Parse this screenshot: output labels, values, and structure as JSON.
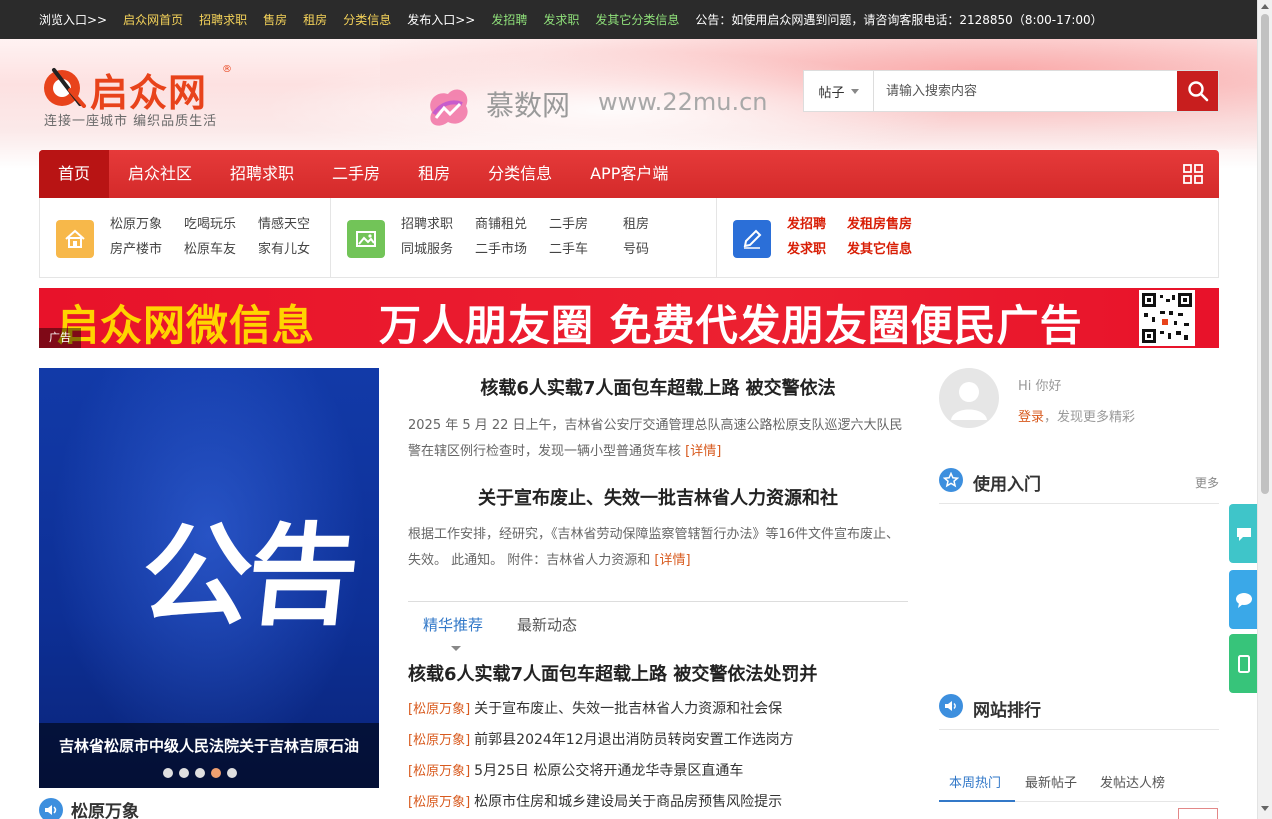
{
  "topbar": {
    "browse_label": "浏览入口>>",
    "home": "启众网首页",
    "jobs": "招聘求职",
    "sell_house": "售房",
    "rent": "租房",
    "classified": "分类信息",
    "publish_label": "发布入口>>",
    "post_job": "发招聘",
    "post_seek": "发求职",
    "post_other": "发其它分类信息",
    "notice": "公告：如使用启众网遇到问题，请咨询客服电话：2128850（8:00-17:00）"
  },
  "logo": {
    "name": "启众网",
    "reg": "®",
    "slogan": "连接一座城市  编织品质生活"
  },
  "watermark": {
    "text": "慕数网",
    "url": "www.22mu.cn"
  },
  "search": {
    "type": "帖子",
    "placeholder": "请输入搜索内容"
  },
  "nav": {
    "items": [
      "首页",
      "启众社区",
      "招聘求职",
      "二手房",
      "租房",
      "分类信息",
      "APP客户端"
    ]
  },
  "quick": {
    "community": [
      "松原万象",
      "吃喝玩乐",
      "情感天空",
      "房产楼市",
      "松原车友",
      "家有儿女"
    ],
    "services": [
      "招聘求职",
      "商铺租兑",
      "二手房",
      "租房",
      "同城服务",
      "二手市场",
      "二手车",
      "号码"
    ],
    "publish": [
      "发招聘",
      "发租房售房",
      "发求职",
      "发其它信息"
    ]
  },
  "banner": {
    "text1": "启众网微信息",
    "text2": "万人朋友圈 免费代发朋友圈便民广告",
    "tag": "广告"
  },
  "slide": {
    "big_text": "公告",
    "caption": "吉林省松原市中级人民法院关于吉林吉原石油",
    "dots_total": 5,
    "active_dot": 4
  },
  "left_section": {
    "title": "松原万象"
  },
  "headlines": [
    {
      "title": "核载6人实载7人面包车超载上路 被交警依法",
      "summary": "2025 年 5 月 22 日上午，吉林省公安厅交通管理总队高速公路松原支队巡逻六大队民警在辖区例行检查时，发现一辆小型普通货车核",
      "more": "[详情]"
    },
    {
      "title": "关于宣布废止、失效一批吉林省人力资源和社",
      "summary": "根据工作安排，经研究，《吉林省劳动保障监察管辖暂行办法》等16件文件宣布废止、失效。 此通知。 附件：吉林省人力资源和",
      "more": "[详情]"
    }
  ],
  "tabs": [
    "精华推荐",
    "最新动态"
  ],
  "top_news": "核载6人实载7人面包车超载上路 被交警依法处罚并",
  "news": [
    {
      "cat": "[松原万象]",
      "title": "关于宣布废止、失效一批吉林省人力资源和社会保"
    },
    {
      "cat": "[松原万象]",
      "title": "前郭县2024年12月退出消防员转岗安置工作选岗方"
    },
    {
      "cat": "[松原万象]",
      "title": "5月25日 松原公交将开通龙华寺景区直通车"
    },
    {
      "cat": "[松原万象]",
      "title": "松原市住房和城乡建设局关于商品房预售风险提示"
    }
  ],
  "user": {
    "greeting": "Hi 你好",
    "login": "登录",
    "login_rest": "，发现更多精彩"
  },
  "right": {
    "guide_title": "使用入门",
    "guide_more": "更多",
    "rank_title": "网站排行",
    "rank_tabs": [
      "本周热门",
      "最新帖子",
      "发帖达人榜"
    ]
  },
  "colors": {
    "nav_red": "#d42a2a",
    "accent_orange": "#d85a1e",
    "link_blue": "#3278c8"
  }
}
